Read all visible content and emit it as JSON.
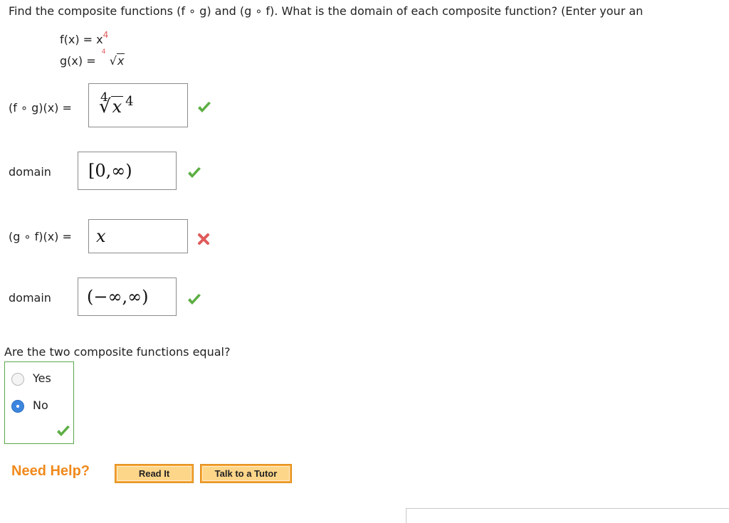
{
  "question": "Find the composite functions (f ∘ g) and (g ∘ f). What is the domain of each composite function? (Enter your an",
  "given": {
    "f_lhs": "f(x) = x",
    "f_exp": "4",
    "g_lhs": "g(x) = ",
    "g_index": "4",
    "g_radicand": "x"
  },
  "fog": {
    "label": "(f ∘ g)(x) =",
    "answer_index": "4",
    "answer_radicand": "x",
    "answer_exp": "4",
    "status": "correct"
  },
  "fog_domain": {
    "label": "domain",
    "answer": "[0,∞)",
    "status": "correct"
  },
  "gof": {
    "label": "(g ∘ f)(x) =",
    "answer": "x",
    "status": "incorrect"
  },
  "gof_domain": {
    "label": "domain",
    "answer": "(−∞,∞)",
    "status": "correct"
  },
  "equal_question": "Are the two composite functions equal?",
  "options": [
    {
      "label": "Yes",
      "selected": false
    },
    {
      "label": "No",
      "selected": true
    }
  ],
  "help": {
    "title": "Need Help?",
    "read_it": "Read It",
    "talk_tutor": "Talk to a Tutor"
  },
  "colors": {
    "check": "#5cae43",
    "cross": "#e05a5a",
    "help_orange": "#f08a1c",
    "radio_selected": "#3d86e0"
  }
}
